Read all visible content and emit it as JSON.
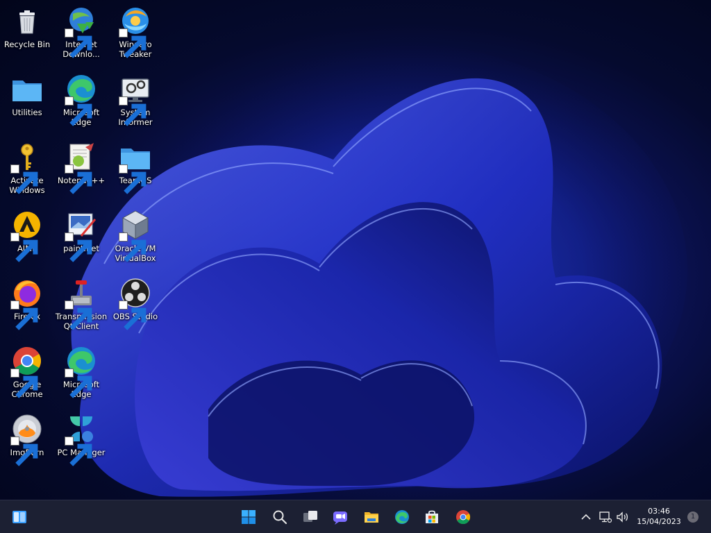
{
  "desktop": {
    "icons": [
      {
        "label": "Recycle Bin",
        "icon": "recycle-bin-icon"
      },
      {
        "label": "Internet\nDownlo...",
        "icon": "internet-download-manager-icon"
      },
      {
        "label": "Winaero\nTweaker",
        "icon": "winaero-tweaker-icon"
      },
      {
        "label": "Utilities",
        "icon": "folder-icon"
      },
      {
        "label": "Microsoft\nEdge",
        "icon": "edge-icon"
      },
      {
        "label": "System\nInformer",
        "icon": "system-informer-icon"
      },
      {
        "label": "Activate\nWindows",
        "icon": "key-icon"
      },
      {
        "label": "Notepad++",
        "icon": "notepad-plus-plus-icon"
      },
      {
        "label": "TeamOS",
        "icon": "folder-icon"
      },
      {
        "label": "AIMP",
        "icon": "aimp-icon"
      },
      {
        "label": "paint.net",
        "icon": "paint-net-icon"
      },
      {
        "label": "Oracle VM\nVirtualBox",
        "icon": "virtualbox-icon"
      },
      {
        "label": "Firefox",
        "icon": "firefox-icon"
      },
      {
        "label": "Transmission\nQt Client",
        "icon": "transmission-icon"
      },
      {
        "label": "OBS Studio",
        "icon": "obs-studio-icon"
      },
      {
        "label": "Google\nChrome",
        "icon": "chrome-icon"
      },
      {
        "label": "Microsoft\nEdge",
        "icon": "edge-icon"
      },
      {
        "label": "ImgBurn",
        "icon": "imgburn-icon"
      },
      {
        "label": "PC Manager",
        "icon": "pc-manager-icon"
      }
    ]
  },
  "taskbar": {
    "left": [
      {
        "icon": "widgets-icon"
      }
    ],
    "center": [
      {
        "icon": "windows-start-icon"
      },
      {
        "icon": "search-icon"
      },
      {
        "icon": "task-view-icon"
      },
      {
        "icon": "chat-icon"
      },
      {
        "icon": "file-explorer-icon"
      },
      {
        "icon": "edge-icon"
      },
      {
        "icon": "microsoft-store-icon"
      },
      {
        "icon": "chrome-icon"
      }
    ],
    "tray": [
      {
        "icon": "chevron-up-icon"
      },
      {
        "icon": "network-icon"
      },
      {
        "icon": "volume-icon"
      }
    ],
    "clock": {
      "time": "03:46",
      "date": "15/04/2023"
    },
    "notification_count": "1"
  },
  "colors": {
    "taskbar_bg": "#1c2033",
    "folder_blue": "#4aa8f0",
    "accent_blue": "#1f5fd6"
  }
}
